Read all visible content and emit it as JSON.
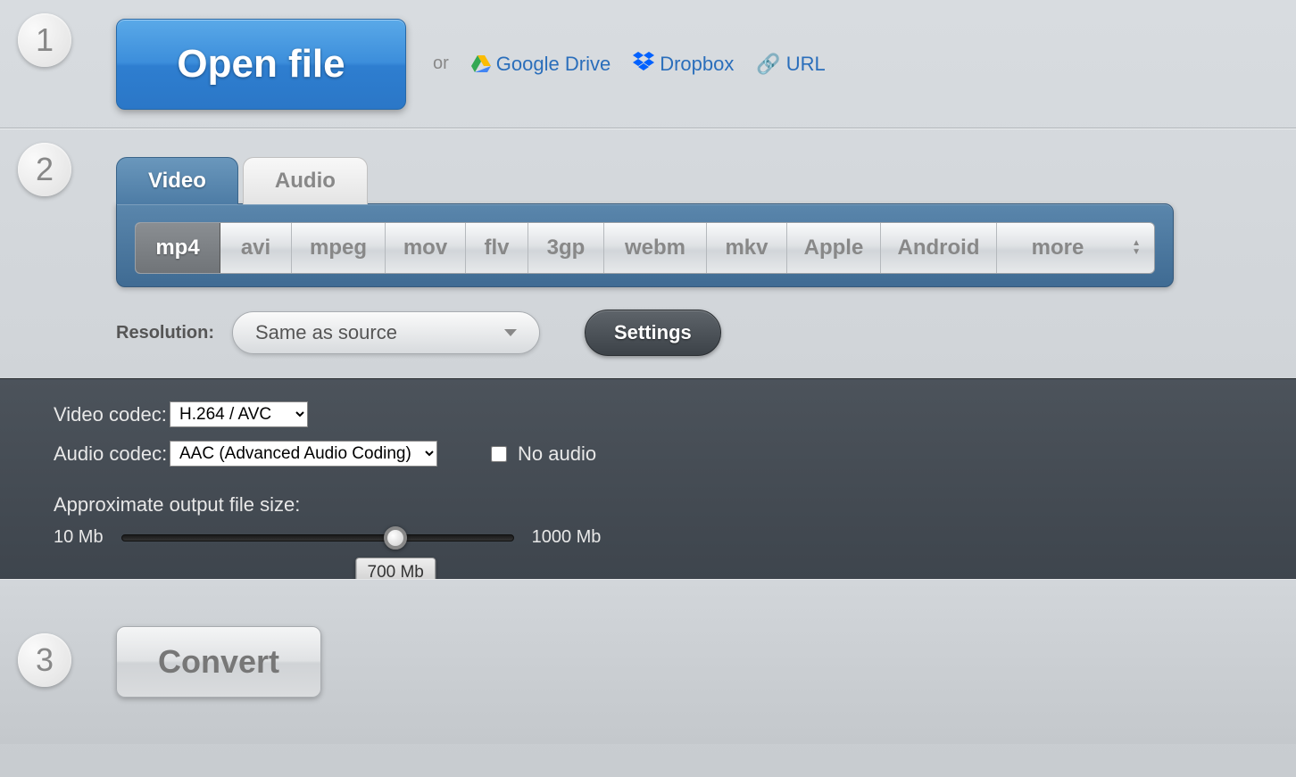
{
  "step1": {
    "number": "1",
    "open_label": "Open file",
    "or": "or",
    "gdrive": "Google Drive",
    "dropbox": "Dropbox",
    "url": "URL"
  },
  "step2": {
    "number": "2",
    "tabs": {
      "video": "Video",
      "audio": "Audio"
    },
    "formats": {
      "mp4": "mp4",
      "avi": "avi",
      "mpeg": "mpeg",
      "mov": "mov",
      "flv": "flv",
      "3gp": "3gp",
      "webm": "webm",
      "mkv": "mkv",
      "apple": "Apple",
      "android": "Android",
      "more": "more"
    },
    "resolution_label": "Resolution:",
    "resolution_value": "Same as source",
    "settings_btn": "Settings"
  },
  "settings": {
    "video_codec_label": "Video codec:",
    "video_codec_value": "H.264 / AVC",
    "audio_codec_label": "Audio codec:",
    "audio_codec_value": "AAC (Advanced Audio Coding)",
    "no_audio_label": "No audio",
    "size_label": "Approximate output file size:",
    "size_min": "10 Mb",
    "size_max": "1000 Mb",
    "size_value": "700 Mb"
  },
  "step3": {
    "number": "3",
    "convert_label": "Convert"
  }
}
